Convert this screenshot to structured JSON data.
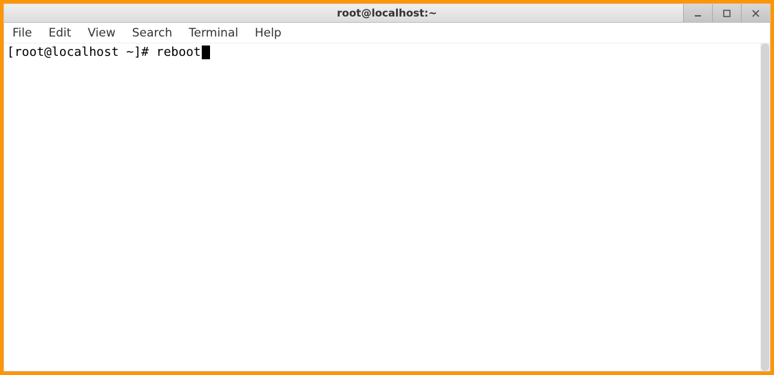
{
  "window": {
    "title": "root@localhost:~"
  },
  "menubar": {
    "items": [
      "File",
      "Edit",
      "View",
      "Search",
      "Terminal",
      "Help"
    ]
  },
  "terminal": {
    "prompt": "[root@localhost ~]# ",
    "command": "reboot"
  }
}
